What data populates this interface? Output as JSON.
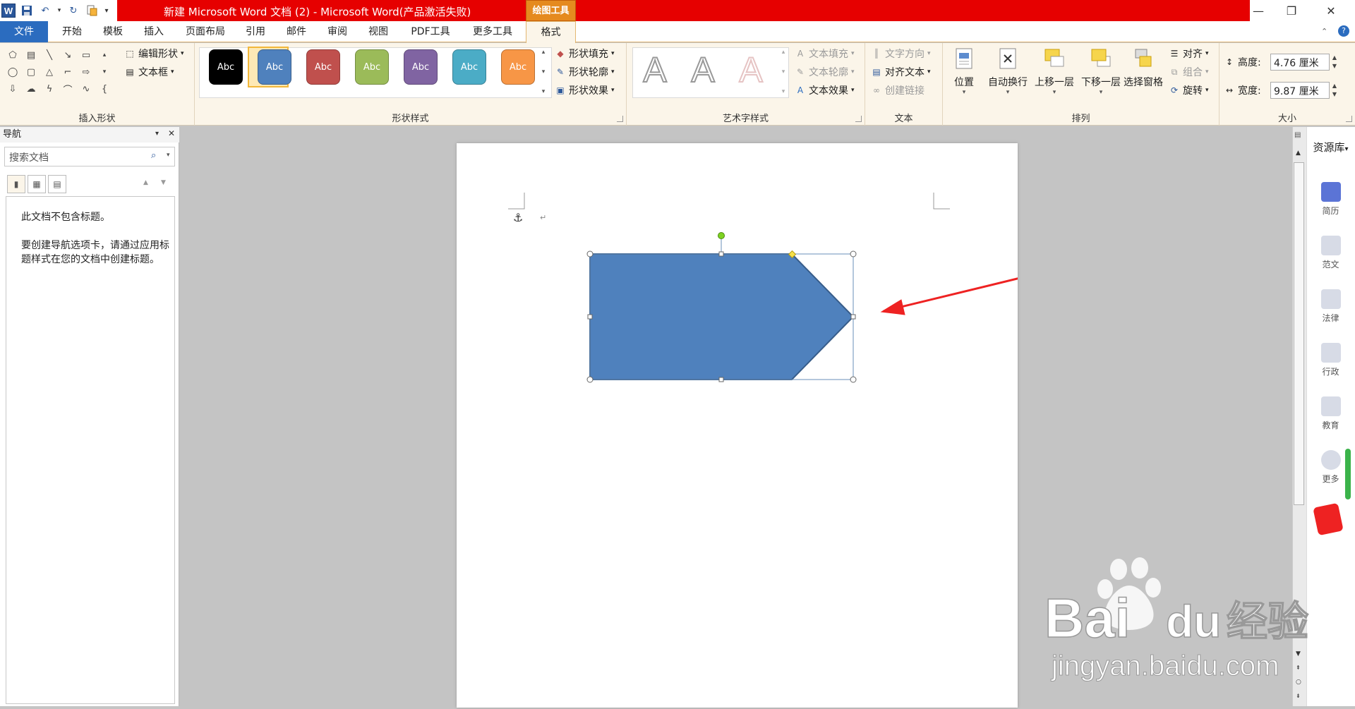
{
  "title_bar": {
    "doc_title": "新建 Microsoft Word 文档 (2)  -  Microsoft Word(产品激活失败)",
    "context_label": "绘图工具",
    "word_icon": "W",
    "minimize": "—",
    "restore": "❐",
    "close": "✕"
  },
  "tabs": {
    "file": "文件",
    "items": [
      "开始",
      "模板",
      "插入",
      "页面布局",
      "引用",
      "邮件",
      "审阅",
      "视图",
      "PDF工具",
      "更多工具"
    ],
    "format": "格式"
  },
  "ribbon": {
    "insert_shapes": {
      "label": "插入形状",
      "edit_shape": "编辑形状",
      "text_box": "文本框"
    },
    "shape_styles": {
      "label": "形状样式",
      "swatch_text": "Abc",
      "swatch_colors": [
        "#000000",
        "#4f81bd",
        "#c0504d",
        "#9bbb59",
        "#8064a2",
        "#4bacc6",
        "#f79646"
      ],
      "fill": "形状填充",
      "outline": "形状轮廓",
      "effects": "形状效果"
    },
    "wordart": {
      "label": "艺术字样式",
      "glyph": "A",
      "text_fill": "文本填充",
      "text_outline": "文本轮廓",
      "text_effects": "文本效果"
    },
    "text": {
      "label": "文本",
      "direction": "文字方向",
      "align": "对齐文本",
      "link": "创建链接"
    },
    "arrange": {
      "label": "排列",
      "position": "位置",
      "wrap": "自动换行",
      "forward": "上移一层",
      "backward": "下移一层",
      "pane": "选择窗格",
      "align": "对齐",
      "group": "组合",
      "rotate": "旋转"
    },
    "size": {
      "label": "大小",
      "height_label": "高度:",
      "height": "4.76 厘米",
      "width_label": "宽度:",
      "width": "9.87 厘米"
    }
  },
  "nav_pane": {
    "title": "导航",
    "search_placeholder": "搜索文档",
    "msg1": "此文档不包含标题。",
    "msg2": "要创建导航选项卡，请通过应用标题样式在您的文档中创建标题。"
  },
  "document": {
    "shape_fill": "#4f81bd",
    "shape_stroke": "#385d8a",
    "annotation_color": "#ee2222",
    "anchor": "⚓",
    "para_mark": "↵"
  },
  "right_sidebar": {
    "header": "资源库",
    "items": [
      "简历",
      "范文",
      "法律",
      "行政",
      "教育",
      "更多"
    ]
  },
  "watermark": {
    "text1": "Bai",
    "text2": "du",
    "text3": "经验",
    "url": "jingyan.baidu.com"
  }
}
